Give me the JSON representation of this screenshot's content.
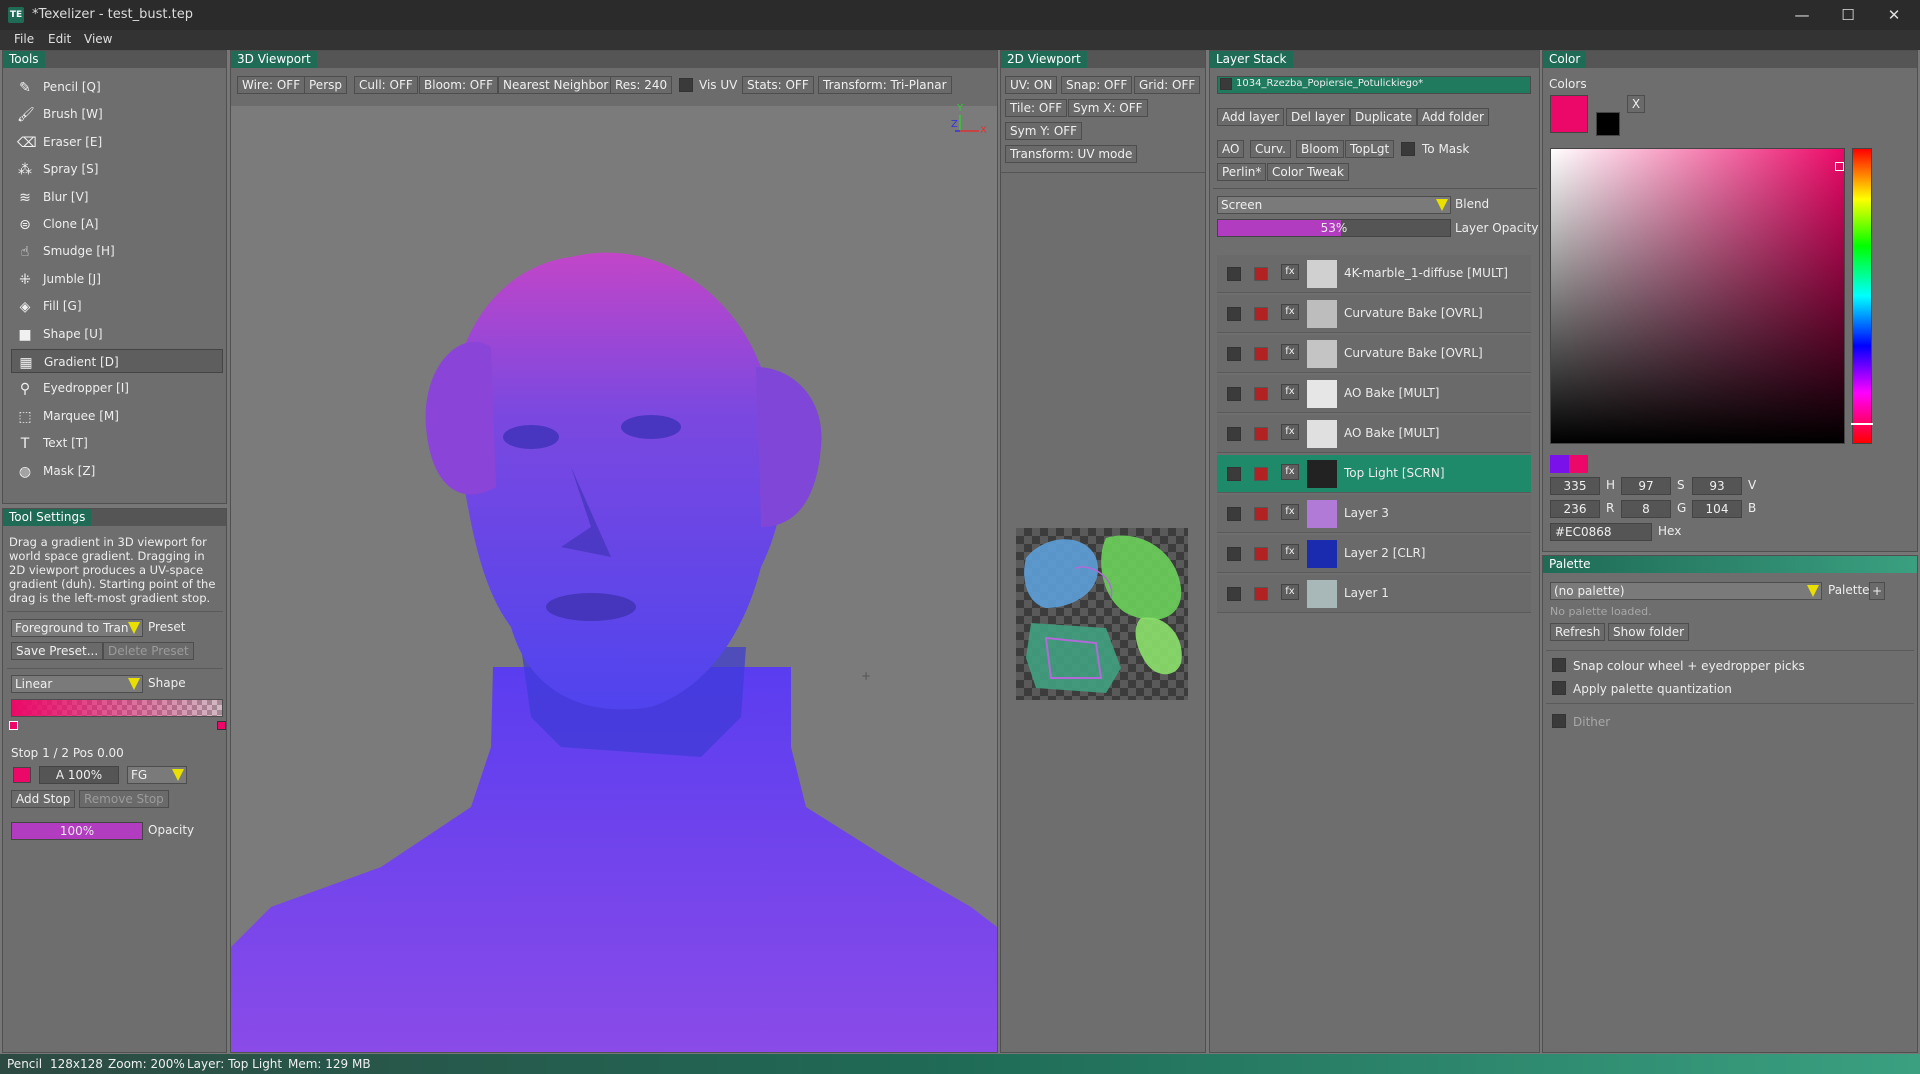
{
  "window": {
    "title": "*Texelizer - test_bust.tep",
    "logo": "TE",
    "minimize_glyph": "—",
    "maximize_glyph": "☐",
    "close_glyph": "✕"
  },
  "menu": {
    "file": "File",
    "edit": "Edit",
    "view": "View"
  },
  "tools": {
    "title": "Tools",
    "items": [
      {
        "label": "Pencil [Q]",
        "icon": "pencil-icon",
        "glyph": "✎"
      },
      {
        "label": "Brush [W]",
        "icon": "brush-icon",
        "glyph": "🖌"
      },
      {
        "label": "Eraser [E]",
        "icon": "eraser-icon",
        "glyph": "⌫"
      },
      {
        "label": "Spray [S]",
        "icon": "spray-icon",
        "glyph": "⁂"
      },
      {
        "label": "Blur [V]",
        "icon": "blur-icon",
        "glyph": "≋"
      },
      {
        "label": "Clone [A]",
        "icon": "clone-icon",
        "glyph": "⊜"
      },
      {
        "label": "Smudge [H]",
        "icon": "smudge-icon",
        "glyph": "☝"
      },
      {
        "label": "Jumble [J]",
        "icon": "jumble-icon",
        "glyph": "⁜"
      },
      {
        "label": "Fill [G]",
        "icon": "fill-icon",
        "glyph": "◈"
      },
      {
        "label": "Shape [U]",
        "icon": "shape-icon",
        "glyph": "■"
      },
      {
        "label": "Gradient [D]",
        "icon": "gradient-icon",
        "glyph": "▦"
      },
      {
        "label": "Eyedropper [I]",
        "icon": "eyedropper-icon",
        "glyph": "⚲"
      },
      {
        "label": "Marquee [M]",
        "icon": "marquee-icon",
        "glyph": "⬚"
      },
      {
        "label": "Text [T]",
        "icon": "text-icon",
        "glyph": "T"
      },
      {
        "label": "Mask [Z]",
        "icon": "mask-icon",
        "glyph": "◍"
      }
    ]
  },
  "tool_settings": {
    "title": "Tool Settings",
    "description": "Drag a gradient in 3D viewport for world space gradient. Dragging in 2D viewport produces a UV-space gradient (duh). Starting point of the drag is the left-most gradient stop.",
    "preset_value": "Foreground to Tran",
    "preset_label": "Preset",
    "save_preset": "Save Preset...",
    "delete_preset": "Delete Preset",
    "shape_value": "Linear",
    "shape_label": "Shape",
    "stop_info": "Stop 1 / 2   Pos 0.00",
    "alpha_value": "A 100%",
    "fg_value": "FG",
    "add_stop": "Add Stop",
    "remove_stop": "Remove Stop",
    "opacity_value": "100%",
    "opacity_label": "Opacity",
    "opacity_fraction": 1.0
  },
  "viewport3d": {
    "title": "3D Viewport",
    "buttons": [
      "Wire: OFF",
      "Persp",
      "Cull: OFF",
      "Bloom: OFF",
      "Nearest Neighbor",
      "Res: 240"
    ],
    "vis_uv": "Vis UV",
    "stats": "Stats: OFF",
    "transform": "Transform: Tri-Planar",
    "gizmo_y": "Y",
    "gizmo_z": "Z",
    "gizmo_x": "X"
  },
  "viewport2d": {
    "title": "2D Viewport",
    "buttons": [
      "UV: ON",
      "Snap: OFF",
      "Grid: OFF",
      "Tile: OFF",
      "Sym X: OFF",
      "Sym Y: OFF",
      "Transform: UV mode"
    ]
  },
  "layer_stack": {
    "title": "Layer Stack",
    "object_name": "1034_Rzezba_Popiersie_Potulickiego*",
    "actions": [
      "Add layer",
      "Del layer",
      "Duplicate",
      "Add folder"
    ],
    "bakes": [
      "AO",
      "Curv.",
      "Bloom",
      "TopLgt"
    ],
    "to_mask": "To Mask",
    "extras": [
      "Perlin*",
      "Color Tweak"
    ],
    "blend_value": "Screen",
    "blend_label": "Blend",
    "opacity_value": "53%",
    "opacity_label": "Layer Opacity",
    "opacity_fraction": 0.53,
    "fx": "fx",
    "layers": [
      {
        "name": "4K-marble_1-diffuse  [MULT]",
        "thumb": "#d0d0d0"
      },
      {
        "name": "Curvature Bake  [OVRL]",
        "thumb": "#bdbdbd"
      },
      {
        "name": "Curvature Bake  [OVRL]",
        "thumb": "#c4c4c4"
      },
      {
        "name": "AO Bake  [MULT]",
        "thumb": "#e6e6e6"
      },
      {
        "name": "AO Bake  [MULT]",
        "thumb": "#e0e0e0"
      },
      {
        "name": "Top Light  [SCRN]",
        "thumb": "#222222"
      },
      {
        "name": "Layer 3",
        "thumb": "#b07ad6"
      },
      {
        "name": "Layer 2  [CLR]",
        "thumb": "#1a2bb0"
      },
      {
        "name": "Layer 1",
        "thumb": "#a8b8b8"
      }
    ]
  },
  "color": {
    "title": "Color",
    "colors_label": "Colors",
    "swap": "X",
    "fg_color": "#EC0868",
    "bg_color": "#000000",
    "h": "335",
    "s": "97",
    "v": "93",
    "r": "236",
    "g": "8",
    "b": "104",
    "h_label": "H",
    "s_label": "S",
    "v_label": "V",
    "r_label": "R",
    "g_label": "G",
    "b_label": "B",
    "hex": "#EC0868",
    "hex_label": "Hex"
  },
  "palette": {
    "title": "Palette",
    "value": "(no palette)",
    "label": "Palette",
    "add": "+",
    "status": "No palette loaded.",
    "refresh": "Refresh",
    "show_folder": "Show folder",
    "snap": "Snap colour wheel + eyedropper picks",
    "quantize": "Apply palette quantization",
    "dither": "Dither"
  },
  "status": [
    "Pencil",
    "128x128",
    "Zoom: 200%",
    "Layer: Top Light",
    "Mem: 129 MB"
  ]
}
